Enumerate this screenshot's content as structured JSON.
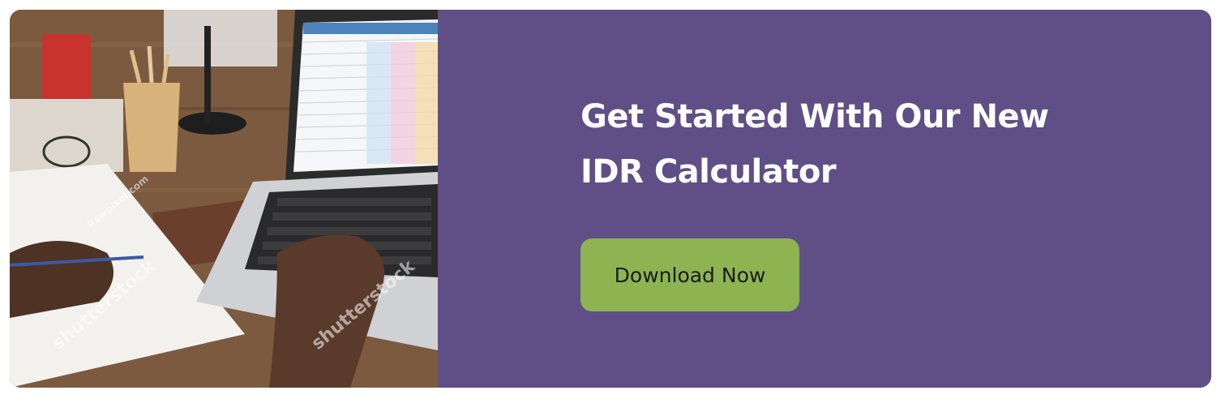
{
  "banner": {
    "headline_line1": "Get Started With Our New",
    "headline_line2": "IDR Calculator",
    "cta_label": "Download Now",
    "photo_watermark": "shutterstock",
    "photo_watermark_2": "Rawpixel.com"
  },
  "colors": {
    "panel_bg": "#5f4f86",
    "cta_bg": "#8db451",
    "headline_text": "#ffffff",
    "cta_text": "#1b1b1b"
  }
}
